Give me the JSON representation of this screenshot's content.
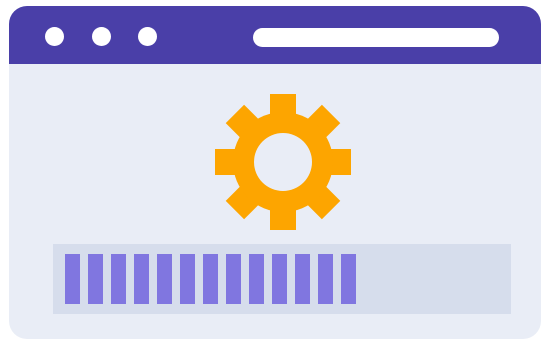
{
  "window": {
    "colors": {
      "titlebar": "#4a3fa8",
      "body": "#e9edf6",
      "accent": "#fda500",
      "progress_fill": "#8076e0",
      "progress_track": "#d6ddec"
    },
    "titlebar_buttons": [
      "window-dot-icon",
      "window-dot-icon",
      "window-dot-icon"
    ],
    "address_bar": {
      "text": ""
    }
  },
  "main": {
    "icon": "gear-icon",
    "progress": {
      "segments_filled": 13,
      "fraction": 0.68
    }
  }
}
